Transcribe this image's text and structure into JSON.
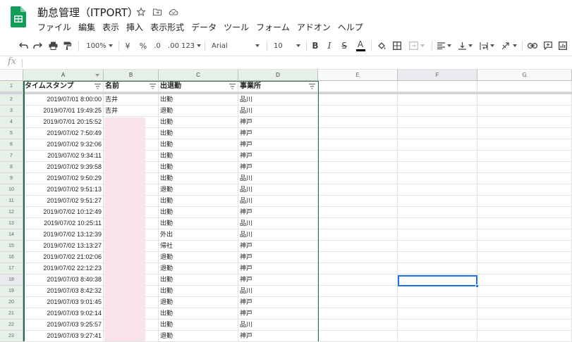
{
  "app": {
    "title": "勤怠管理（ITPORT）",
    "menu": [
      "ファイル",
      "編集",
      "表示",
      "挿入",
      "表示形式",
      "データ",
      "ツール",
      "フォーム",
      "アドオン",
      "ヘルプ"
    ]
  },
  "toolbar": {
    "zoom": "100%",
    "currency": "¥",
    "percent": "%",
    "decrease_decimals": ".0",
    "increase_decimals": ".00",
    "more_formats": "123",
    "font": "Arial",
    "font_size": "10",
    "bold": "B",
    "italic": "I",
    "strikethrough": "S",
    "text_color": "A"
  },
  "formula_bar": {
    "fx": "fx",
    "value": ""
  },
  "grid": {
    "columns": [
      "A",
      "B",
      "C",
      "D",
      "E",
      "F",
      "G"
    ],
    "header_row": {
      "number": "1",
      "cells": [
        "タイムスタンプ",
        "名前",
        "出退勤",
        "事業所"
      ]
    },
    "rows": [
      {
        "n": "2",
        "a": "2019/07/01 8:00:00",
        "b": "吉井",
        "c": "出勤",
        "d": "品川"
      },
      {
        "n": "3",
        "a": "2019/07/01 19:49:25",
        "b": "吉井",
        "c": "退勤",
        "d": "品川"
      },
      {
        "n": "4",
        "a": "2019/07/01 20:15:52",
        "b": "",
        "c": "出勤",
        "d": "神戸"
      },
      {
        "n": "5",
        "a": "2019/07/02 7:50:49",
        "b": "",
        "c": "出勤",
        "d": "神戸"
      },
      {
        "n": "6",
        "a": "2019/07/02 9:32:06",
        "b": "",
        "c": "出勤",
        "d": "神戸"
      },
      {
        "n": "7",
        "a": "2019/07/02 9:34:11",
        "b": "",
        "c": "出勤",
        "d": "神戸"
      },
      {
        "n": "8",
        "a": "2019/07/02 9:39:58",
        "b": "",
        "c": "出勤",
        "d": "神戸"
      },
      {
        "n": "9",
        "a": "2019/07/02 9:50:29",
        "b": "",
        "c": "出勤",
        "d": "品川"
      },
      {
        "n": "10",
        "a": "2019/07/02 9:51:13",
        "b": "",
        "c": "退勤",
        "d": "品川"
      },
      {
        "n": "11",
        "a": "2019/07/02 9:51:27",
        "b": "",
        "c": "出勤",
        "d": "品川"
      },
      {
        "n": "12",
        "a": "2019/07/02 10:12:49",
        "b": "",
        "c": "出勤",
        "d": "神戸"
      },
      {
        "n": "13",
        "a": "2019/07/02 10:25:11",
        "b": "",
        "c": "出勤",
        "d": "品川"
      },
      {
        "n": "14",
        "a": "2019/07/02 13:12:39",
        "b": "",
        "c": "外出",
        "d": "品川"
      },
      {
        "n": "15",
        "a": "2019/07/02 13:13:27",
        "b": "",
        "c": "帰社",
        "d": "神戸"
      },
      {
        "n": "16",
        "a": "2019/07/02 21:02:06",
        "b": "",
        "c": "退勤",
        "d": "神戸"
      },
      {
        "n": "17",
        "a": "2019/07/02 22:12:23",
        "b": "",
        "c": "退勤",
        "d": "神戸"
      },
      {
        "n": "18",
        "a": "2019/07/03 8:40:38",
        "b": "",
        "c": "出勤",
        "d": "神戸"
      },
      {
        "n": "19",
        "a": "2019/07/03 8:42:32",
        "b": "",
        "c": "出勤",
        "d": "品川"
      },
      {
        "n": "20",
        "a": "2019/07/03 9:01:45",
        "b": "",
        "c": "退勤",
        "d": "神戸"
      },
      {
        "n": "21",
        "a": "2019/07/03 9:02:14",
        "b": "",
        "c": "出勤",
        "d": "神戸"
      },
      {
        "n": "22",
        "a": "2019/07/03 9:25:57",
        "b": "",
        "c": "出勤",
        "d": "品川"
      },
      {
        "n": "23",
        "a": "2019/07/03 9:27:41",
        "b": "",
        "c": "退勤",
        "d": "神戸"
      }
    ]
  },
  "colors": {
    "sheets_green": "#0f9d58",
    "selection_green": "#1e7145",
    "active_blue": "#1a73e8",
    "redaction_pink": "#f9e3ea"
  }
}
